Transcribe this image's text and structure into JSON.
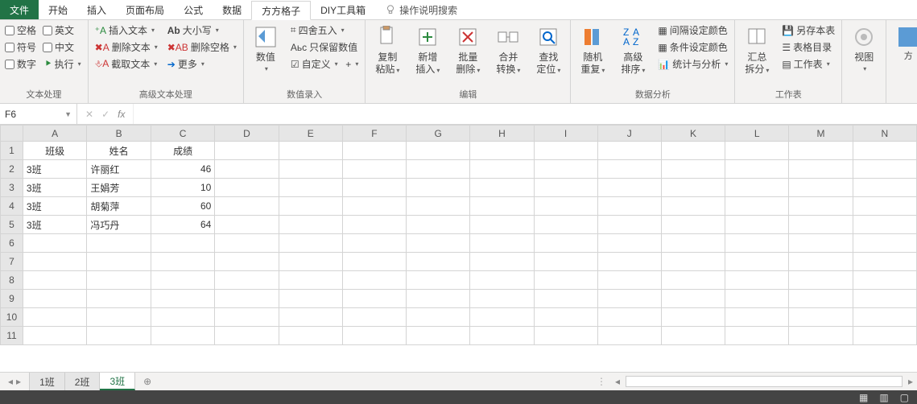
{
  "menu": {
    "file": "文件",
    "items": [
      "开始",
      "插入",
      "页面布局",
      "公式",
      "数据",
      "方方格子",
      "DIY工具箱"
    ],
    "active_index": 5,
    "search_placeholder": "操作说明搜索"
  },
  "ribbon": {
    "g1": {
      "label": "文本处理",
      "checks": [
        [
          "空格",
          "英文"
        ],
        [
          "符号",
          "中文"
        ],
        [
          "数字",
          "执行"
        ]
      ]
    },
    "g2": {
      "label": "高级文本处理",
      "rows": [
        {
          "icon": "insert-text",
          "label": "插入文本",
          "icon2": "case",
          "label2": "大小写"
        },
        {
          "icon": "delete-text",
          "label": "删除文本",
          "icon2": "delete-space",
          "label2": "删除空格"
        },
        {
          "icon": "cut-text",
          "label": "截取文本",
          "icon2": "more",
          "label2": "更多"
        }
      ]
    },
    "g3": {
      "label": "数值录入",
      "big": {
        "label": "数值"
      },
      "rows": [
        "四舍五入",
        "只保留数值",
        "自定义"
      ]
    },
    "g4": {
      "label": "编辑",
      "bigs": [
        {
          "name": "copy-paste",
          "label": "复制粘贴"
        },
        {
          "name": "insert-new",
          "label": "新增插入"
        },
        {
          "name": "batch-delete",
          "label": "批量删除"
        },
        {
          "name": "merge-convert",
          "label": "合并转换"
        },
        {
          "name": "find-locate",
          "label": "查找定位"
        }
      ]
    },
    "g5": {
      "label": "数据分析",
      "bigs": [
        {
          "name": "random-repeat",
          "label": "随机重复"
        },
        {
          "name": "advanced-sort",
          "label": "高级排序"
        }
      ],
      "rows": [
        "间隔设定颜色",
        "条件设定颜色",
        "统计与分析"
      ]
    },
    "g6": {
      "label": "工作表",
      "big": {
        "name": "summary-split",
        "label": "汇总拆分"
      },
      "rows": [
        "另存本表",
        "表格目录",
        "工作表"
      ]
    },
    "g7": {
      "label": "",
      "big": {
        "name": "view",
        "label": "视图"
      }
    },
    "g8": {
      "big": {
        "name": "ff",
        "label": "方"
      }
    }
  },
  "formula_bar": {
    "cell_ref": "F6",
    "formula": ""
  },
  "columns": [
    "A",
    "B",
    "C",
    "D",
    "E",
    "F",
    "G",
    "H",
    "I",
    "J",
    "K",
    "L",
    "M",
    "N"
  ],
  "headers": [
    "班级",
    "姓名",
    "成绩"
  ],
  "rows": [
    {
      "a": "3班",
      "b": "许丽红",
      "c": 46
    },
    {
      "a": "3班",
      "b": "王娟芳",
      "c": 10
    },
    {
      "a": "3班",
      "b": "胡菊萍",
      "c": 60
    },
    {
      "a": "3班",
      "b": "冯巧丹",
      "c": 64
    }
  ],
  "blank_rows": [
    6,
    7,
    8,
    9,
    10,
    11
  ],
  "sheet_tabs": [
    "1班",
    "2班",
    "3班"
  ],
  "active_sheet_index": 2
}
